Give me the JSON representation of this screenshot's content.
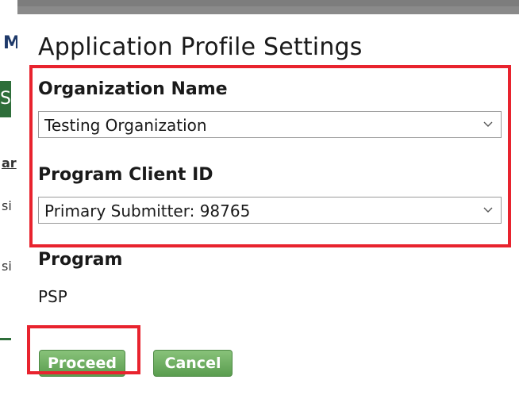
{
  "background": {
    "fragment_letter": "M",
    "green_fragment": "So",
    "text_fragment_1": "ar",
    "text_fragment_2": "si",
    "text_fragment_3": "si"
  },
  "dialog": {
    "title": "Application Profile Settings",
    "organization": {
      "label": "Organization Name",
      "selected": "Testing Organization"
    },
    "client_id": {
      "label": "Program Client ID",
      "selected": "Primary Submitter: 98765"
    },
    "program": {
      "label": "Program",
      "value": "PSP"
    },
    "buttons": {
      "proceed": "Proceed",
      "cancel": "Cancel"
    }
  },
  "colors": {
    "highlight": "#e8232e",
    "button_green": "#6aab5e"
  }
}
